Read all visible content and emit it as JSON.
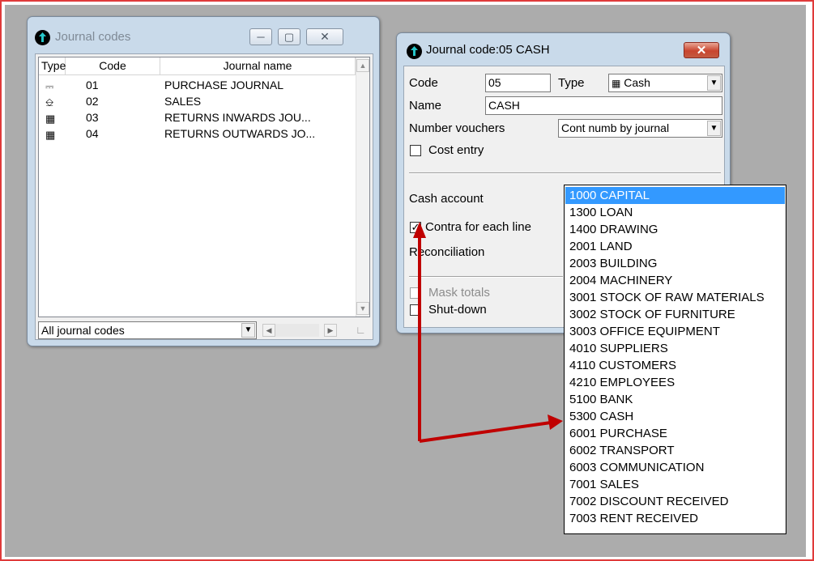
{
  "journal_codes_window": {
    "title": "Journal codes",
    "columns": [
      "Type",
      "Code",
      "Journal name"
    ],
    "rows": [
      {
        "type_icon": "purchase-journal-icon",
        "code": "01",
        "name": "PURCHASE JOURNAL"
      },
      {
        "type_icon": "sales-journal-icon",
        "code": "02",
        "name": "SALES"
      },
      {
        "type_icon": "returns-journal-icon",
        "code": "03",
        "name": "RETURNS INWARDS JOU..."
      },
      {
        "type_icon": "returns-journal-icon",
        "code": "04",
        "name": "RETURNS OUTWARDS JO..."
      }
    ],
    "filter_value": "All journal codes"
  },
  "journal_code_dialog": {
    "title": "Journal code:05 CASH",
    "code_label": "Code",
    "code_value": "05",
    "type_label": "Type",
    "type_value": "Cash",
    "name_label": "Name",
    "name_value": "CASH",
    "number_vouchers_label": "Number vouchers",
    "number_vouchers_value": "Cont numb by journal",
    "cost_entry_label": "Cost entry",
    "cost_entry_checked": false,
    "cash_account_label": "Cash account",
    "contra_label": "Contra for each line",
    "contra_checked": true,
    "reconciliation_label": "Reconciliation",
    "mask_totals_label": "Mask totals",
    "shutdown_label": "Shut-down"
  },
  "cash_account_dropdown": {
    "selected_index": 0,
    "items": [
      "1000 CAPITAL",
      "1300 LOAN",
      "1400 DRAWING",
      "2001 LAND",
      "2003 BUILDING",
      "2004 MACHINERY",
      "3001 STOCK OF RAW MATERIALS",
      "3002 STOCK OF FURNITURE",
      "3003 OFFICE EQUIPMENT",
      "4010 SUPPLIERS",
      "4110 CUSTOMERS",
      "4210 EMPLOYEES",
      "5100 BANK",
      "5300 CASH",
      "6001 PURCHASE",
      "6002 TRANSPORT",
      "6003 COMMUNICATION",
      "7001 SALES",
      "7002 DISCOUNT RECEIVED",
      "7003 RENT RECEIVED"
    ]
  },
  "colors": {
    "annotation_arrow": "#c00000",
    "selection": "#3399ff",
    "frame_border": "#e03a3a",
    "desktop": "#acacac"
  }
}
